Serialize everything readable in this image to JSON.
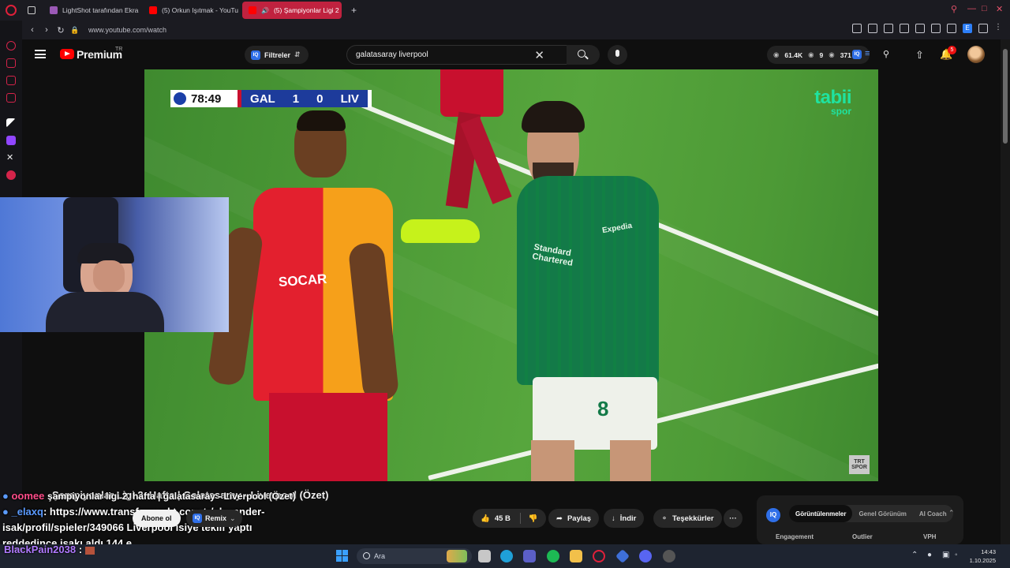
{
  "browser": {
    "tabs": [
      {
        "label": "LightShot tarafından Ekra",
        "favicon_color": "#9b59b6"
      },
      {
        "label": "(5) Orkun Işıtmak - YouTu",
        "favicon_color": "#ff0000"
      },
      {
        "label": "(5) Şampiyonlar Ligi 2",
        "favicon_color": "#ff0000",
        "active": true
      }
    ],
    "new_tab": "+",
    "url": "www.youtube.com/watch",
    "profile_letter": "E"
  },
  "youtube": {
    "brand": "Premium",
    "brand_region": "TR",
    "filters_label": "Filtreler",
    "search_value": "galatasaray liverpool",
    "stats": {
      "views": "61.4K",
      "likes": "9",
      "viewers": "371"
    },
    "notifications": "5"
  },
  "video": {
    "clock": "78:49",
    "home": "GAL",
    "home_score": "1",
    "away_score": "0",
    "away": "LIV",
    "broadcaster": "tabii",
    "broadcaster_sub": "spor",
    "channel_bug": "TRT SPOR",
    "title": "Şampiyonlar Ligi 2. Hafta | Galatasaray - Liverpool (Özet)",
    "jersey_sponsor_home": "SOCAR",
    "jersey_sponsor_away": "Standard Chartered",
    "jersey_sleeve_away": "Expedia",
    "number_away": "8"
  },
  "actions": {
    "subscribe": "Abone ol",
    "remix": "Remix",
    "likes": "45 B",
    "share": "Paylaş",
    "download": "İndir",
    "thanks": "Teşekkürler",
    "more": "···"
  },
  "iq_panel": {
    "tabs": [
      "Görüntülenmeler",
      "Genel Görünüm",
      "AI Coach"
    ],
    "columns": [
      "Engagement",
      "Outlier",
      "VPH"
    ]
  },
  "chat": [
    {
      "user": "oomee",
      "text": "şampiyonlar ligi 2. hafta | galatasaray - Liverpool (Özet)",
      "user_color": "pink"
    },
    {
      "user": "_elaxq",
      "text": ": https://www.transfermarkt.com.tr/alexander-"
    },
    {
      "user": "",
      "text": "isak/profil/spieler/349066 Liverpool isiye teklif yaptı"
    },
    {
      "user": "",
      "text": "reddedince isakı aldı 144 e"
    },
    {
      "user": "BlackPain2038",
      "text": " : ",
      "user_color": "purple"
    }
  ],
  "taskbar": {
    "search_placeholder": "Ara",
    "weather": "19°C",
    "time": "14:43",
    "date": "1.10.2025"
  }
}
